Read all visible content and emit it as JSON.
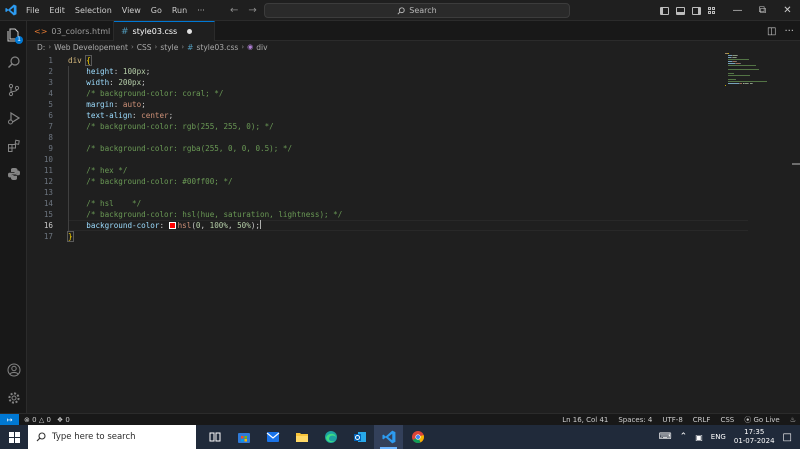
{
  "menu": {
    "items": [
      "File",
      "Edit",
      "Selection",
      "View",
      "Go",
      "Run",
      "···"
    ]
  },
  "search": {
    "label": "Search"
  },
  "tabs": [
    {
      "label": "03_colors.html",
      "active": false
    },
    {
      "label": "style03.css",
      "active": true,
      "modified": true
    }
  ],
  "breadcrumb": {
    "parts": [
      "D:",
      "Web Developement",
      "CSS",
      "style",
      "style03.css",
      "div"
    ]
  },
  "editor": {
    "current_line": 16,
    "lines": [
      {
        "n": "1",
        "tokens": [
          [
            "t-sel",
            "div "
          ],
          [
            "t-brace-hl",
            "{"
          ]
        ]
      },
      {
        "n": "2",
        "tokens": [
          [
            "t-punc",
            "    "
          ],
          [
            "t-prop",
            "height"
          ],
          [
            "t-punc",
            ": "
          ],
          [
            "t-num",
            "100px"
          ],
          [
            "t-punc",
            ";"
          ]
        ]
      },
      {
        "n": "3",
        "tokens": [
          [
            "t-punc",
            "    "
          ],
          [
            "t-prop",
            "width"
          ],
          [
            "t-punc",
            ": "
          ],
          [
            "t-num",
            "200px"
          ],
          [
            "t-punc",
            ";"
          ]
        ]
      },
      {
        "n": "4",
        "tokens": [
          [
            "t-punc",
            "    "
          ],
          [
            "t-com",
            "/* background-color: coral; */"
          ]
        ]
      },
      {
        "n": "5",
        "tokens": [
          [
            "t-punc",
            "    "
          ],
          [
            "t-prop",
            "margin"
          ],
          [
            "t-punc",
            ": "
          ],
          [
            "t-val",
            "auto"
          ],
          [
            "t-punc",
            ";"
          ]
        ]
      },
      {
        "n": "6",
        "tokens": [
          [
            "t-punc",
            "    "
          ],
          [
            "t-prop",
            "text-align"
          ],
          [
            "t-punc",
            ": "
          ],
          [
            "t-val",
            "center"
          ],
          [
            "t-punc",
            ";"
          ]
        ]
      },
      {
        "n": "7",
        "tokens": [
          [
            "t-punc",
            "    "
          ],
          [
            "t-com",
            "/* background-color: rgb(255, 255, 0); */"
          ]
        ]
      },
      {
        "n": "8",
        "tokens": []
      },
      {
        "n": "9",
        "tokens": [
          [
            "t-punc",
            "    "
          ],
          [
            "t-com",
            "/* background-color: rgba(255, 0, 0, 0.5); */"
          ]
        ]
      },
      {
        "n": "10",
        "tokens": []
      },
      {
        "n": "11",
        "tokens": [
          [
            "t-punc",
            "    "
          ],
          [
            "t-com",
            "/* hex */"
          ]
        ]
      },
      {
        "n": "12",
        "tokens": [
          [
            "t-punc",
            "    "
          ],
          [
            "t-com",
            "/* background-color: #00ff00; */"
          ]
        ]
      },
      {
        "n": "13",
        "tokens": []
      },
      {
        "n": "14",
        "tokens": [
          [
            "t-punc",
            "    "
          ],
          [
            "t-com",
            "/* hsl    */"
          ]
        ]
      },
      {
        "n": "15",
        "tokens": [
          [
            "t-punc",
            "    "
          ],
          [
            "t-com",
            "/* background-color: hsl(hue, saturation, lightness); */"
          ]
        ]
      },
      {
        "n": "16",
        "tokens": [
          [
            "t-punc",
            "    "
          ],
          [
            "t-prop",
            "background-color"
          ],
          [
            "t-punc",
            ": "
          ],
          [
            "swatch",
            ""
          ],
          [
            "t-val",
            "hsl"
          ],
          [
            "t-punc",
            "("
          ],
          [
            "t-num",
            "0"
          ],
          [
            "t-punc",
            ", "
          ],
          [
            "t-num",
            "100%"
          ],
          [
            "t-punc",
            ", "
          ],
          [
            "t-num",
            "50%"
          ],
          [
            "t-punc",
            ");"
          ],
          [
            "caret",
            ""
          ]
        ]
      },
      {
        "n": "17",
        "tokens": [
          [
            "t-brace-hl",
            "}"
          ]
        ]
      }
    ]
  },
  "statusbar": {
    "errors": "0",
    "warnings": "0",
    "ports": "0",
    "position": "Ln 16, Col 41",
    "spaces": "Spaces: 4",
    "encoding": "UTF-8",
    "eol": "CRLF",
    "language": "CSS",
    "golive": "Go Live"
  },
  "taskbar": {
    "search_placeholder": "Type here to search",
    "lang": "ENG",
    "time": "17:35",
    "date": "01-07-2024"
  },
  "colors": {
    "accent": "#0078d4",
    "swatch": "#ff0000"
  }
}
